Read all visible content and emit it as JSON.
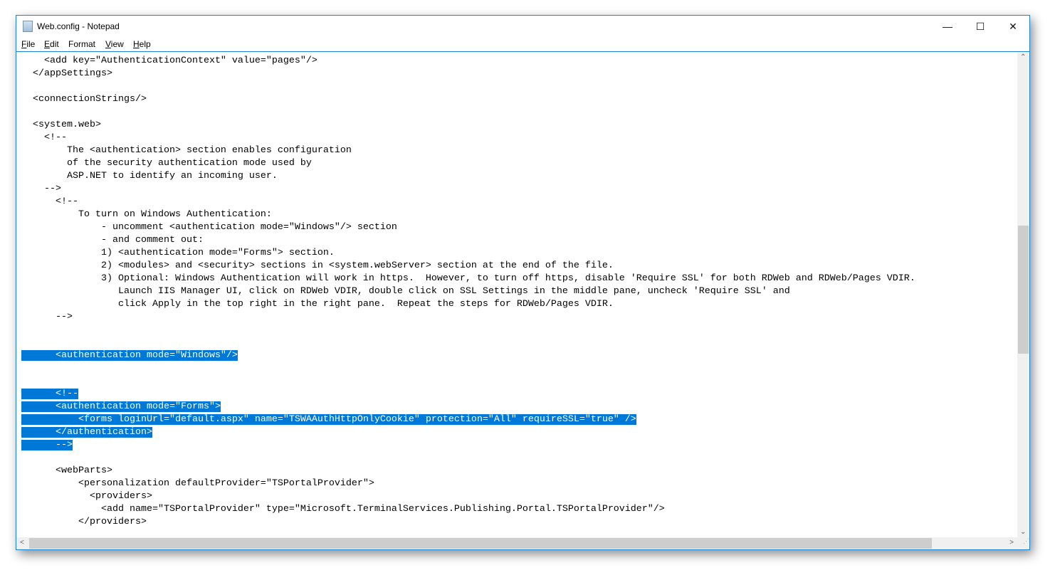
{
  "window": {
    "title": "Web.config - Notepad",
    "controls": {
      "minimize": "—",
      "maximize": "☐",
      "close": "✕"
    }
  },
  "menu": [
    {
      "key": "F",
      "rest": "ile"
    },
    {
      "key": "E",
      "rest": "dit"
    },
    {
      "key": "F",
      "rest": "ormat",
      "prefix": "",
      "label": "Format"
    },
    {
      "key": "V",
      "rest": "iew"
    },
    {
      "key": "H",
      "rest": "elp"
    }
  ],
  "editor": {
    "selected_lines": [
      23,
      26,
      27,
      28,
      29,
      30
    ],
    "lines": [
      "    <add key=\"AuthenticationContext\" value=\"pages\"/>",
      "  </appSettings>",
      "",
      "  <connectionStrings/>",
      "",
      "  <system.web>",
      "    <!--",
      "        The <authentication> section enables configuration",
      "        of the security authentication mode used by",
      "        ASP.NET to identify an incoming user.",
      "    -->",
      "      <!--",
      "          To turn on Windows Authentication:",
      "              - uncomment <authentication mode=\"Windows\"/> section",
      "              - and comment out:",
      "              1) <authentication mode=\"Forms\"> section.",
      "              2) <modules> and <security> sections in <system.webServer> section at the end of the file.",
      "              3) Optional: Windows Authentication will work in https.  However, to turn off https, disable 'Require SSL' for both RDWeb and RDWeb/Pages VDIR.",
      "                 Launch IIS Manager UI, click on RDWeb VDIR, double click on SSL Settings in the middle pane, uncheck 'Require SSL' and",
      "                 click Apply in the top right in the right pane.  Repeat the steps for RDWeb/Pages VDIR.",
      "      -->",
      "",
      "",
      "      <authentication mode=\"Windows\"/>",
      "",
      "",
      "      <!--",
      "      <authentication mode=\"Forms\">",
      "          <forms loginUrl=\"default.aspx\" name=\"TSWAAuthHttpOnlyCookie\" protection=\"All\" requireSSL=\"true\" />",
      "      </authentication>",
      "      -->",
      "",
      "      <webParts>",
      "          <personalization defaultProvider=\"TSPortalProvider\">",
      "            <providers>",
      "              <add name=\"TSPortalProvider\" type=\"Microsoft.TerminalServices.Publishing.Portal.TSPortalProvider\"/>",
      "          </providers>"
    ]
  },
  "colors": {
    "selection": "#0078d7",
    "border": "#1883d7"
  }
}
